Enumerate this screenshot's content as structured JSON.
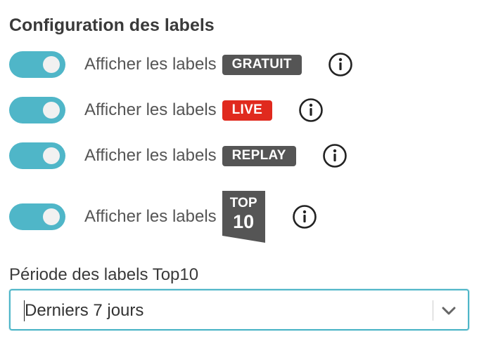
{
  "section_title": "Configuration des labels",
  "rows": [
    {
      "label": "Afficher les labels",
      "badge": "GRATUIT",
      "badge_color": "#555555",
      "enabled": true
    },
    {
      "label": "Afficher les labels",
      "badge": "LIVE",
      "badge_color": "#e02a1e",
      "enabled": true
    },
    {
      "label": "Afficher les labels",
      "badge": "REPLAY",
      "badge_color": "#555555",
      "enabled": true
    },
    {
      "label": "Afficher les labels",
      "badge_top": "TOP",
      "badge_number": "10",
      "badge_color": "#555555",
      "enabled": true
    }
  ],
  "icons": {
    "info": "info-circle-icon",
    "chevron": "chevron-down-icon"
  },
  "period": {
    "label": "Période des labels Top10",
    "selected": "Derniers 7 jours"
  },
  "colors": {
    "accent": "#4fb6c8",
    "badge_dark": "#555555",
    "badge_live": "#e02a1e"
  }
}
